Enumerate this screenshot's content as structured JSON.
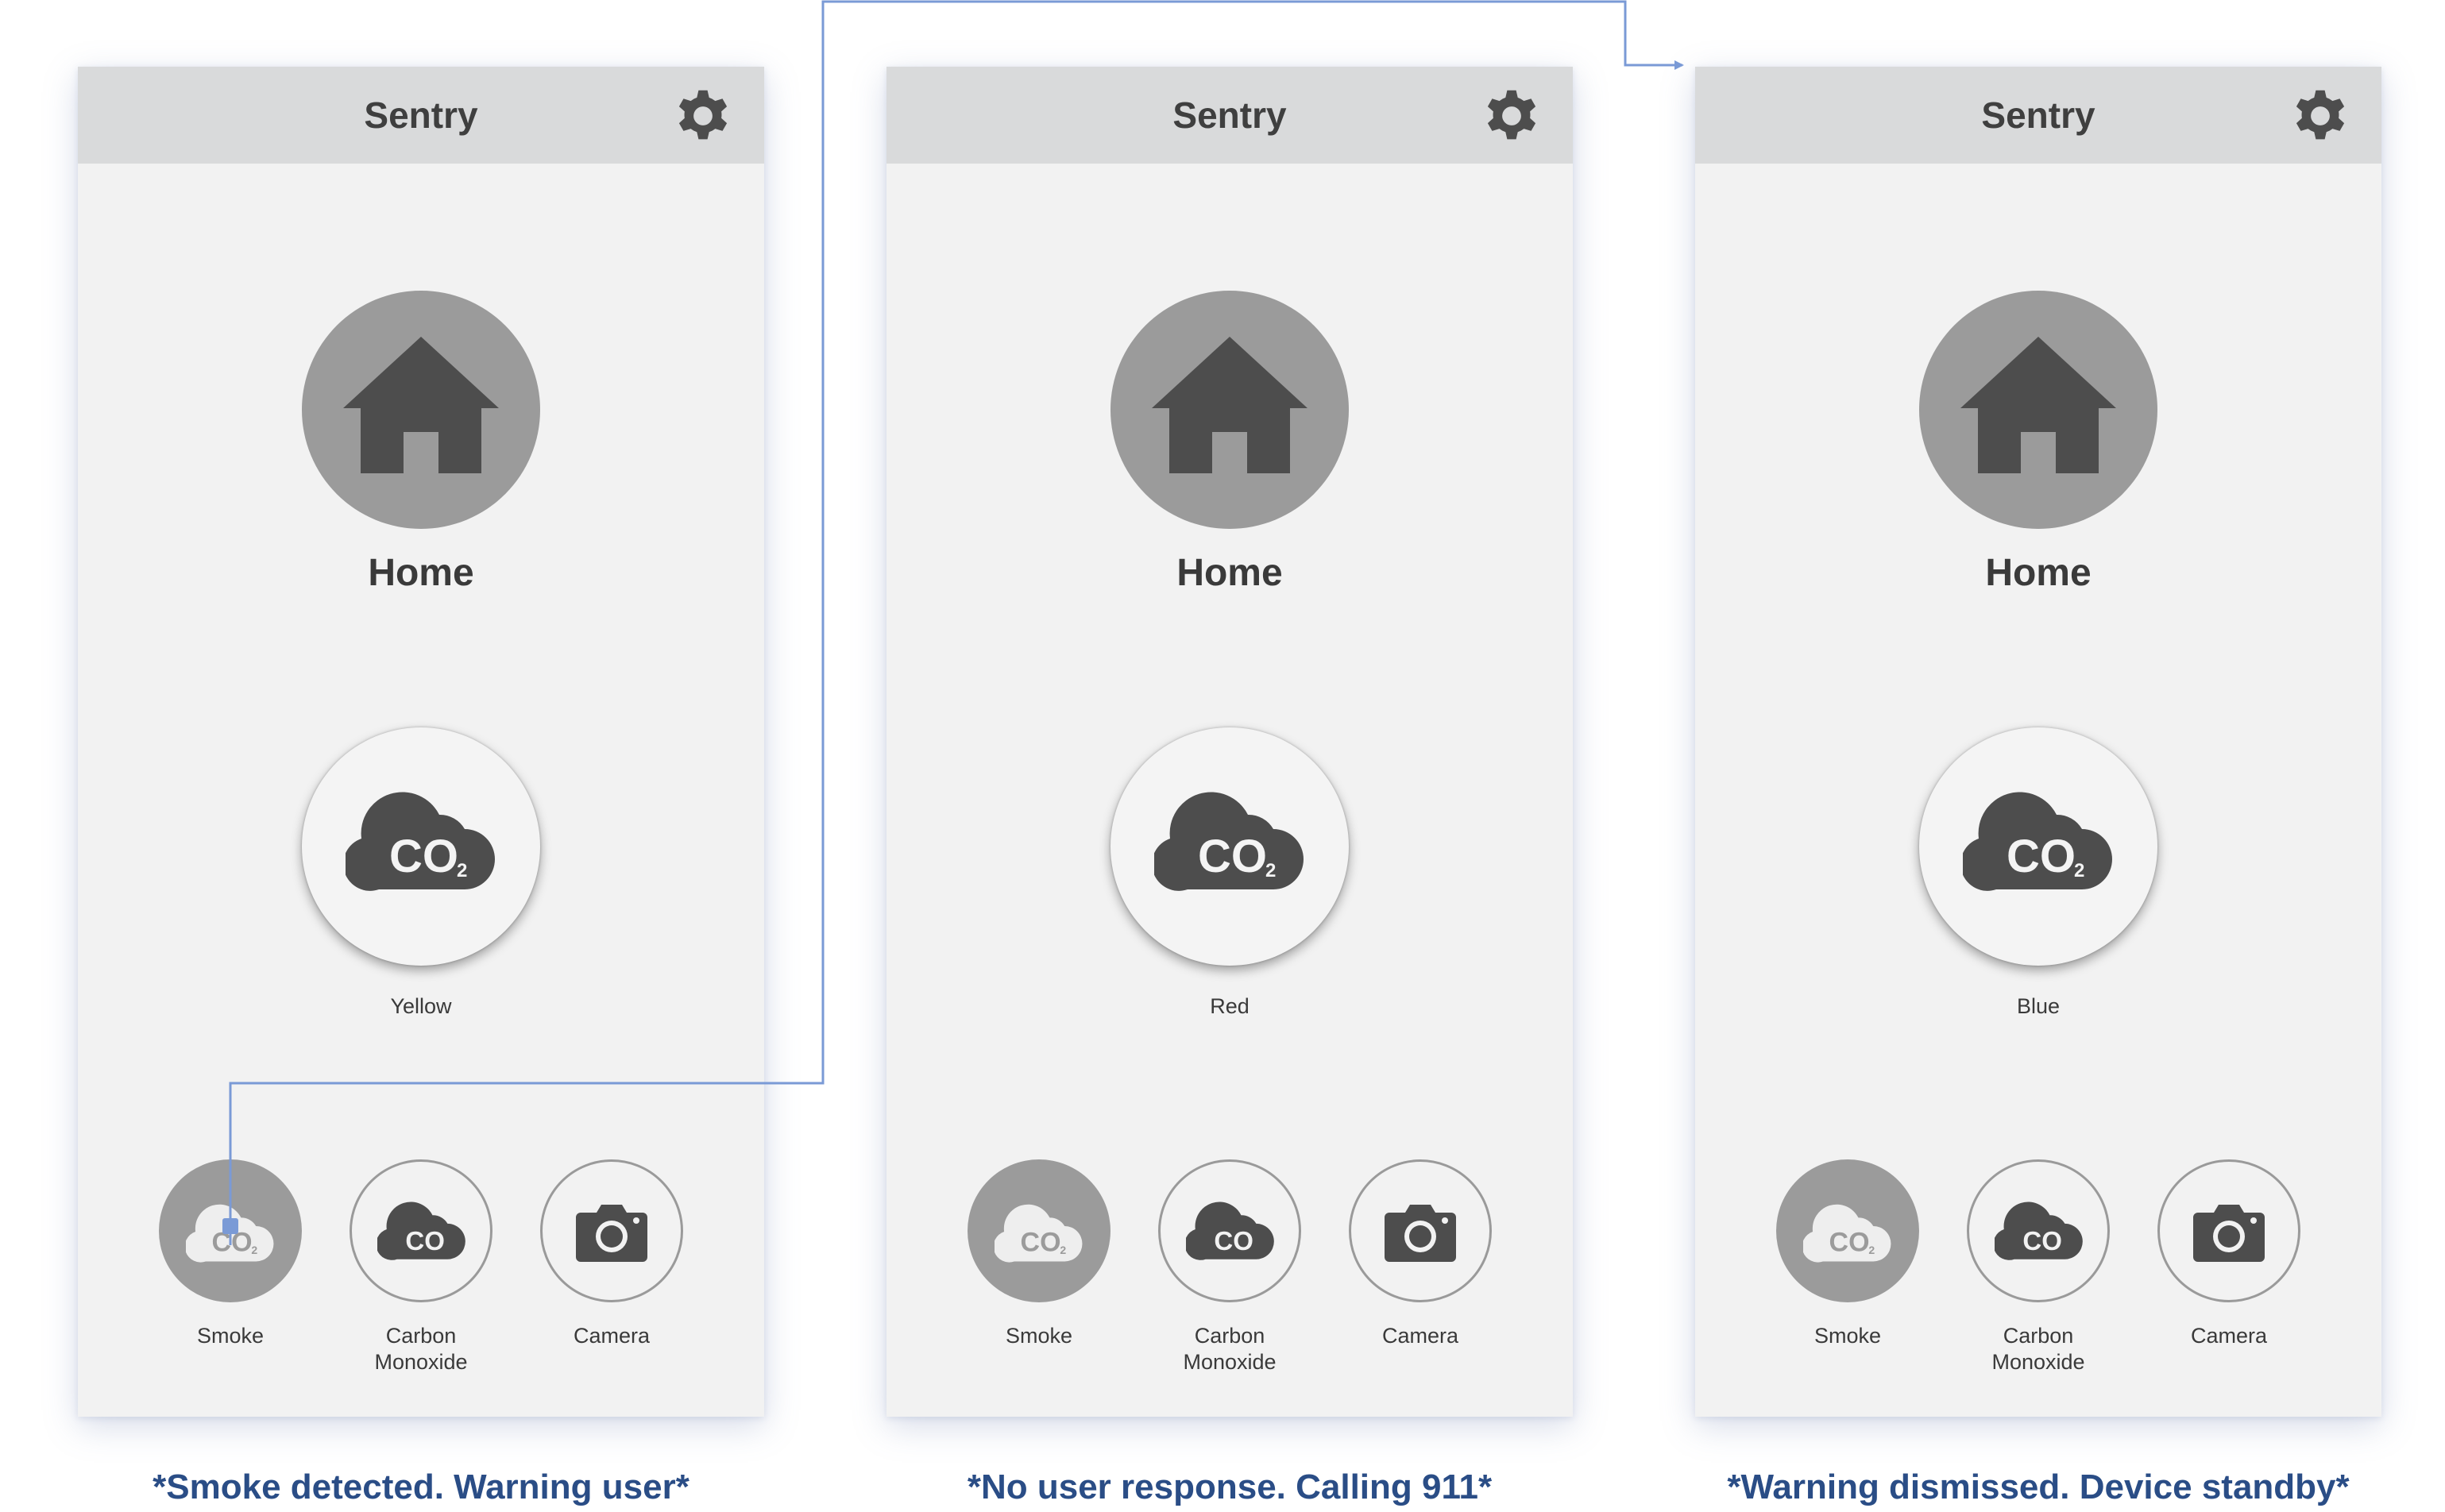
{
  "app": {
    "title": "Sentry"
  },
  "colors": {
    "connector": "#7a9ad6",
    "caption": "#2a4d86",
    "header": "#d9dadb",
    "panel": "#f2f2f2",
    "icon_dark": "#4d4d4d",
    "icon_medium": "#9b9b9b"
  },
  "screens": [
    {
      "header_title": "Sentry",
      "settings_icon": "gear-icon",
      "location_label": "Home",
      "location_icon": "home-icon",
      "status_icon": "co2-cloud-icon",
      "status_label": "Yellow",
      "sensors": [
        {
          "label": "Smoke",
          "icon": "co2-cloud-icon",
          "active": true
        },
        {
          "label": "Carbon\nMonoxide",
          "icon": "co-cloud-icon",
          "active": false
        },
        {
          "label": "Camera",
          "icon": "camera-icon",
          "active": false
        }
      ],
      "caption": "*Smoke detected. Warning user*"
    },
    {
      "header_title": "Sentry",
      "settings_icon": "gear-icon",
      "location_label": "Home",
      "location_icon": "home-icon",
      "status_icon": "co2-cloud-icon",
      "status_label": "Red",
      "sensors": [
        {
          "label": "Smoke",
          "icon": "co2-cloud-icon",
          "active": true
        },
        {
          "label": "Carbon\nMonoxide",
          "icon": "co-cloud-icon",
          "active": false
        },
        {
          "label": "Camera",
          "icon": "camera-icon",
          "active": false
        }
      ],
      "caption": "*No user response. Calling 911*"
    },
    {
      "header_title": "Sentry",
      "settings_icon": "gear-icon",
      "location_label": "Home",
      "location_icon": "home-icon",
      "status_icon": "co2-cloud-icon",
      "status_label": "Blue",
      "sensors": [
        {
          "label": "Smoke",
          "icon": "co2-cloud-icon",
          "active": true
        },
        {
          "label": "Carbon\nMonoxide",
          "icon": "co-cloud-icon",
          "active": false
        },
        {
          "label": "Camera",
          "icon": "camera-icon",
          "active": false
        }
      ],
      "caption": "*Warning dismissed. Device standby*"
    }
  ]
}
